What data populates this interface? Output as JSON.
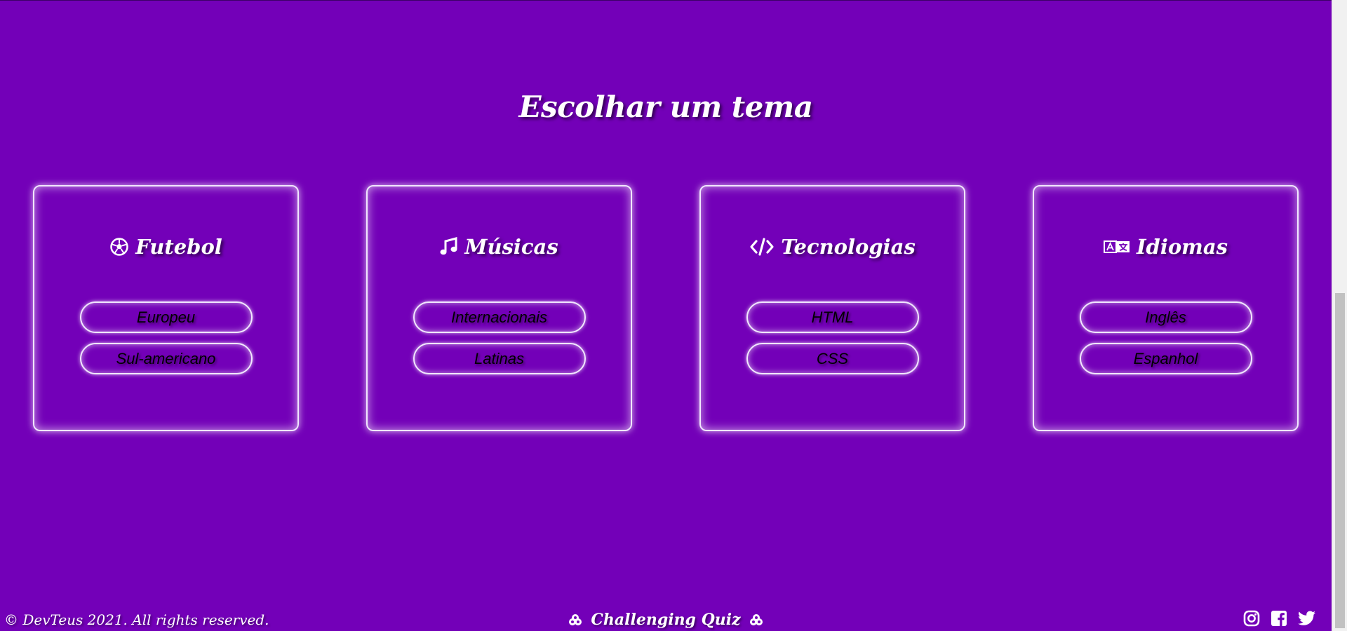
{
  "page": {
    "title": "Escolhar um tema"
  },
  "themes": [
    {
      "title": "Futebol",
      "icon": "soccer-ball-icon",
      "options": [
        "Europeu",
        "Sul-americano"
      ]
    },
    {
      "title": "Músicas",
      "icon": "music-note-icon",
      "options": [
        "Internacionais",
        "Latinas"
      ]
    },
    {
      "title": "Tecnologias",
      "icon": "code-icon",
      "options": [
        "HTML",
        "CSS"
      ]
    },
    {
      "title": "Idiomas",
      "icon": "translate-icon",
      "options": [
        "Inglês",
        "Espanhol"
      ]
    }
  ],
  "footer": {
    "copyright": "© DevTeus 2021. All rights reserved.",
    "brand": "Challenging Quiz",
    "brand_icon": "cookie-bite-icon",
    "social": [
      "instagram-icon",
      "facebook-icon",
      "twitter-icon"
    ]
  },
  "colors": {
    "background": "#7300b8",
    "text": "#ffffff",
    "border_glow": "#f1e6ff"
  }
}
